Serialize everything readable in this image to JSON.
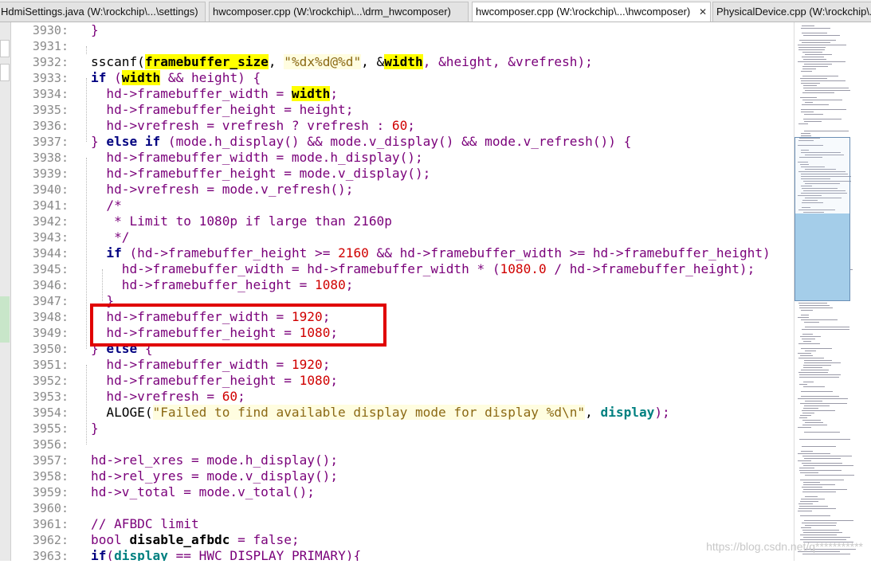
{
  "tabs": [
    {
      "label": "HdmiSettings.java (W:\\rockchip\\...\\settings)",
      "active": false
    },
    {
      "label": "hwcomposer.cpp (W:\\rockchip\\...\\drm_hwcomposer)",
      "active": false
    },
    {
      "label": "hwcomposer.cpp (W:\\rockchip\\...\\hwcomposer)",
      "active": true,
      "close": "✕"
    },
    {
      "label": "PhysicalDevice.cpp (W:\\rockchip\\...",
      "active": false
    }
  ],
  "line_numbers": [
    "3930:",
    "3931:",
    "3932:",
    "3933:",
    "3934:",
    "3935:",
    "3936:",
    "3937:",
    "3938:",
    "3939:",
    "3940:",
    "3941:",
    "3942:",
    "3943:",
    "3944:",
    "3945:",
    "3946:",
    "3947:",
    "3948:",
    "3949:",
    "3950:",
    "3951:",
    "3952:",
    "3953:",
    "3954:",
    "3955:",
    "3956:",
    "3957:",
    "3958:",
    "3959:",
    "3960:",
    "3961:",
    "3962:",
    "3963:"
  ],
  "code_lines": [
    [
      {
        "t": "}",
        "c": "t"
      }
    ],
    [],
    [
      {
        "t": "sscanf(",
        "c": "p"
      },
      {
        "t": "framebuffer_size",
        "c": "hl"
      },
      {
        "t": ", ",
        "c": "p"
      },
      {
        "t": "\"%dx%d@%d\"",
        "c": "s"
      },
      {
        "t": ", &",
        "c": "p"
      },
      {
        "t": "width",
        "c": "hl"
      },
      {
        "t": ", &height, &vrefresh);",
        "c": "t"
      }
    ],
    [
      {
        "t": "if",
        "c": "k"
      },
      {
        "t": " (",
        "c": "t"
      },
      {
        "t": "width",
        "c": "hl"
      },
      {
        "t": " && height) {",
        "c": "t"
      }
    ],
    [
      {
        "t": "  hd->framebuffer_width = ",
        "c": "t"
      },
      {
        "t": "width",
        "c": "hl"
      },
      {
        "t": ";",
        "c": "t"
      }
    ],
    [
      {
        "t": "  hd->framebuffer_height = height;",
        "c": "t"
      }
    ],
    [
      {
        "t": "  hd->vrefresh = vrefresh ? vrefresh : ",
        "c": "t"
      },
      {
        "t": "60",
        "c": "n"
      },
      {
        "t": ";",
        "c": "t"
      }
    ],
    [
      {
        "t": "} ",
        "c": "t"
      },
      {
        "t": "else if",
        "c": "k"
      },
      {
        "t": " (mode.h_display() && mode.v_display() && mode.v_refresh()) {",
        "c": "t"
      }
    ],
    [
      {
        "t": "  hd->framebuffer_width = mode.h_display();",
        "c": "t"
      }
    ],
    [
      {
        "t": "  hd->framebuffer_height = mode.v_display();",
        "c": "t"
      }
    ],
    [
      {
        "t": "  hd->vrefresh = mode.v_refresh();",
        "c": "t"
      }
    ],
    [
      {
        "t": "  /*",
        "c": "c"
      }
    ],
    [
      {
        "t": "   * Limit to 1080p if large than 2160p",
        "c": "c"
      }
    ],
    [
      {
        "t": "   */",
        "c": "c"
      }
    ],
    [
      {
        "t": "  ",
        "c": "t"
      },
      {
        "t": "if",
        "c": "k"
      },
      {
        "t": " (hd->framebuffer_height >= ",
        "c": "t"
      },
      {
        "t": "2160",
        "c": "n"
      },
      {
        "t": " && hd->framebuffer_width >= hd->framebuffer_height)",
        "c": "t"
      }
    ],
    [
      {
        "t": "    hd->framebuffer_width = hd->framebuffer_width * (",
        "c": "t"
      },
      {
        "t": "1080.0",
        "c": "n"
      },
      {
        "t": " / hd->framebuffer_height);",
        "c": "t"
      }
    ],
    [
      {
        "t": "    hd->framebuffer_height = ",
        "c": "t"
      },
      {
        "t": "1080",
        "c": "n"
      },
      {
        "t": ";",
        "c": "t"
      }
    ],
    [
      {
        "t": "  }",
        "c": "t"
      }
    ],
    [
      {
        "t": "  hd->framebuffer_width = ",
        "c": "t"
      },
      {
        "t": "1920",
        "c": "n"
      },
      {
        "t": ";",
        "c": "t"
      }
    ],
    [
      {
        "t": "  hd->framebuffer_height = ",
        "c": "t"
      },
      {
        "t": "1080",
        "c": "n"
      },
      {
        "t": ";",
        "c": "t"
      }
    ],
    [
      {
        "t": "} ",
        "c": "t"
      },
      {
        "t": "else",
        "c": "k"
      },
      {
        "t": " {",
        "c": "t"
      }
    ],
    [
      {
        "t": "  hd->framebuffer_width = ",
        "c": "t"
      },
      {
        "t": "1920",
        "c": "n"
      },
      {
        "t": ";",
        "c": "t"
      }
    ],
    [
      {
        "t": "  hd->framebuffer_height = ",
        "c": "t"
      },
      {
        "t": "1080",
        "c": "n"
      },
      {
        "t": ";",
        "c": "t"
      }
    ],
    [
      {
        "t": "  hd->vrefresh = ",
        "c": "t"
      },
      {
        "t": "60",
        "c": "n"
      },
      {
        "t": ";",
        "c": "t"
      }
    ],
    [
      {
        "t": "  ALOGE(",
        "c": "p"
      },
      {
        "t": "\"Failed to find available display mode for display %d\\n\"",
        "c": "s"
      },
      {
        "t": ", ",
        "c": "p"
      },
      {
        "t": "display",
        "c": "teal"
      },
      {
        "t": ");",
        "c": "t"
      }
    ],
    [
      {
        "t": "}",
        "c": "t"
      }
    ],
    [],
    [
      {
        "t": "hd->rel_xres = mode.h_display();",
        "c": "t"
      }
    ],
    [
      {
        "t": "hd->rel_yres = mode.v_display();",
        "c": "t"
      }
    ],
    [
      {
        "t": "hd->v_total = mode.v_total();",
        "c": "t"
      }
    ],
    [],
    [
      {
        "t": "// AFBDC limit",
        "c": "c"
      }
    ],
    [
      {
        "t": "bool ",
        "c": "t"
      },
      {
        "t": "disable_afbdc",
        "c": "bb"
      },
      {
        "t": " = false;",
        "c": "t"
      }
    ],
    [
      {
        "t": "if",
        "c": "k"
      },
      {
        "t": "(",
        "c": "t"
      },
      {
        "t": "display",
        "c": "teal"
      },
      {
        "t": " == HWC_DISPLAY_PRIMARY){",
        "c": "t"
      }
    ]
  ],
  "watermark": "https://blog.csdn.net/q***********",
  "colors": {
    "keyword": "#000080",
    "identifier": "#7a007a",
    "number": "#d00000",
    "string": "#8b6914",
    "highlight": "#ffff00",
    "annotation": "#e00000"
  }
}
